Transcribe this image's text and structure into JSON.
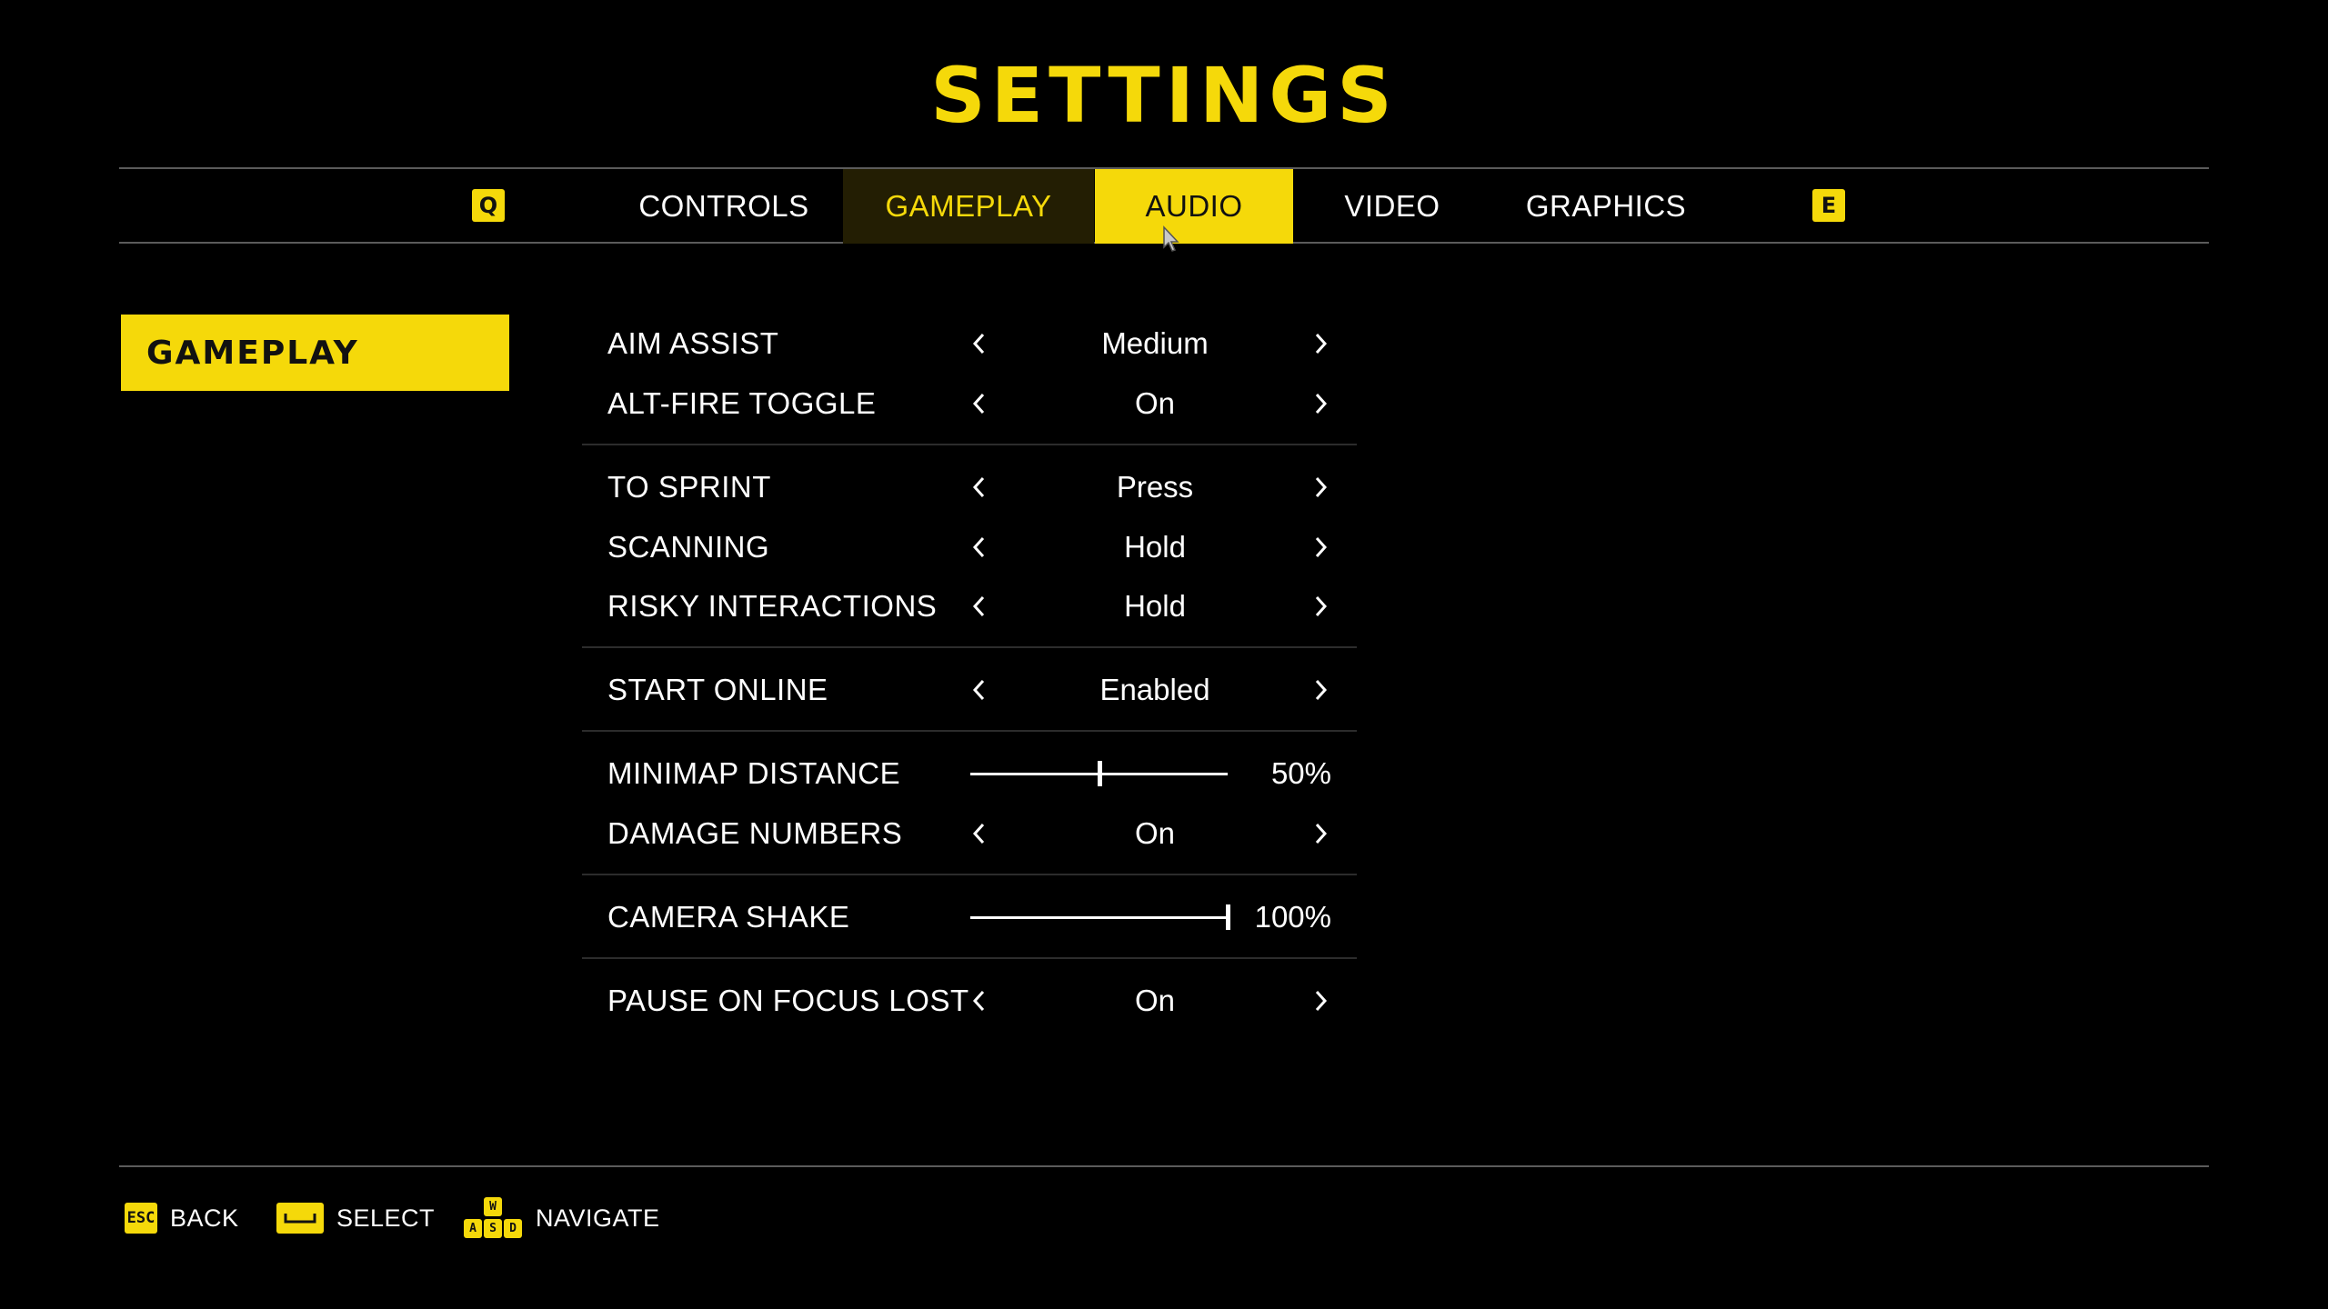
{
  "title": "SETTINGS",
  "colors": {
    "accent": "#f5d90a",
    "background": "#000000",
    "text": "#ffffff",
    "divider": "#5b5b5b"
  },
  "tabs": {
    "prev_key": "Q",
    "next_key": "E",
    "items": [
      {
        "label": "CONTROLS",
        "state": "normal"
      },
      {
        "label": "GAMEPLAY",
        "state": "selected"
      },
      {
        "label": "AUDIO",
        "state": "hover"
      },
      {
        "label": "VIDEO",
        "state": "normal"
      },
      {
        "label": "GRAPHICS",
        "state": "normal"
      }
    ]
  },
  "section": {
    "label": "GAMEPLAY"
  },
  "settings": [
    {
      "label": "AIM ASSIST",
      "type": "selector",
      "value": "Medium"
    },
    {
      "label": "ALT-FIRE TOGGLE",
      "type": "selector",
      "value": "On"
    },
    {
      "label": "TO SPRINT",
      "type": "selector",
      "value": "Press"
    },
    {
      "label": "SCANNING",
      "type": "selector",
      "value": "Hold"
    },
    {
      "label": "RISKY INTERACTIONS",
      "type": "selector",
      "value": "Hold"
    },
    {
      "label": "START ONLINE",
      "type": "selector",
      "value": "Enabled"
    },
    {
      "label": "MINIMAP DISTANCE",
      "type": "slider",
      "value": "50%",
      "level": 0.5
    },
    {
      "label": "DAMAGE NUMBERS",
      "type": "selector",
      "value": "On"
    },
    {
      "label": "CAMERA SHAKE",
      "type": "slider",
      "value": "100%",
      "level": 1.0
    },
    {
      "label": "PAUSE ON FOCUS LOST",
      "type": "selector",
      "value": "On"
    }
  ],
  "footer": {
    "back": {
      "key": "ESC",
      "label": "BACK"
    },
    "select": {
      "key": "space-bar",
      "label": "SELECT"
    },
    "navigate": {
      "keys": [
        "W",
        "A",
        "S",
        "D"
      ],
      "label": "NAVIGATE"
    }
  }
}
